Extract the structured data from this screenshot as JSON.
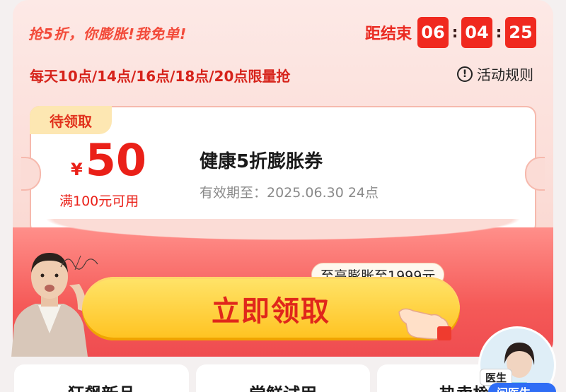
{
  "promo": {
    "title": "抢5折，你膨胀!我免单!",
    "countdown_label": "距结束",
    "countdown": [
      "06",
      "04",
      "25"
    ],
    "schedule": "每天10点/14点/16点/18点/20点限量抢",
    "rules_label": "活动规则"
  },
  "coupon": {
    "badge": "待领取",
    "currency": "¥",
    "amount": "50",
    "condition": "满100元可用",
    "name": "健康5折膨胀券",
    "validity": "有效期至：2025.06.30 24点"
  },
  "cta": {
    "bubble": "至高膨胀至1999元",
    "label": "立即领取"
  },
  "tabs": [
    "狂飙新品",
    "尝鲜试用",
    "热卖榜"
  ],
  "doctor": {
    "badge": "医生",
    "pill": "问医生"
  },
  "colors": {
    "accent": "#f0291f",
    "cta_yellow": "#ffc21f",
    "badge_bg": "#fde7b2"
  }
}
